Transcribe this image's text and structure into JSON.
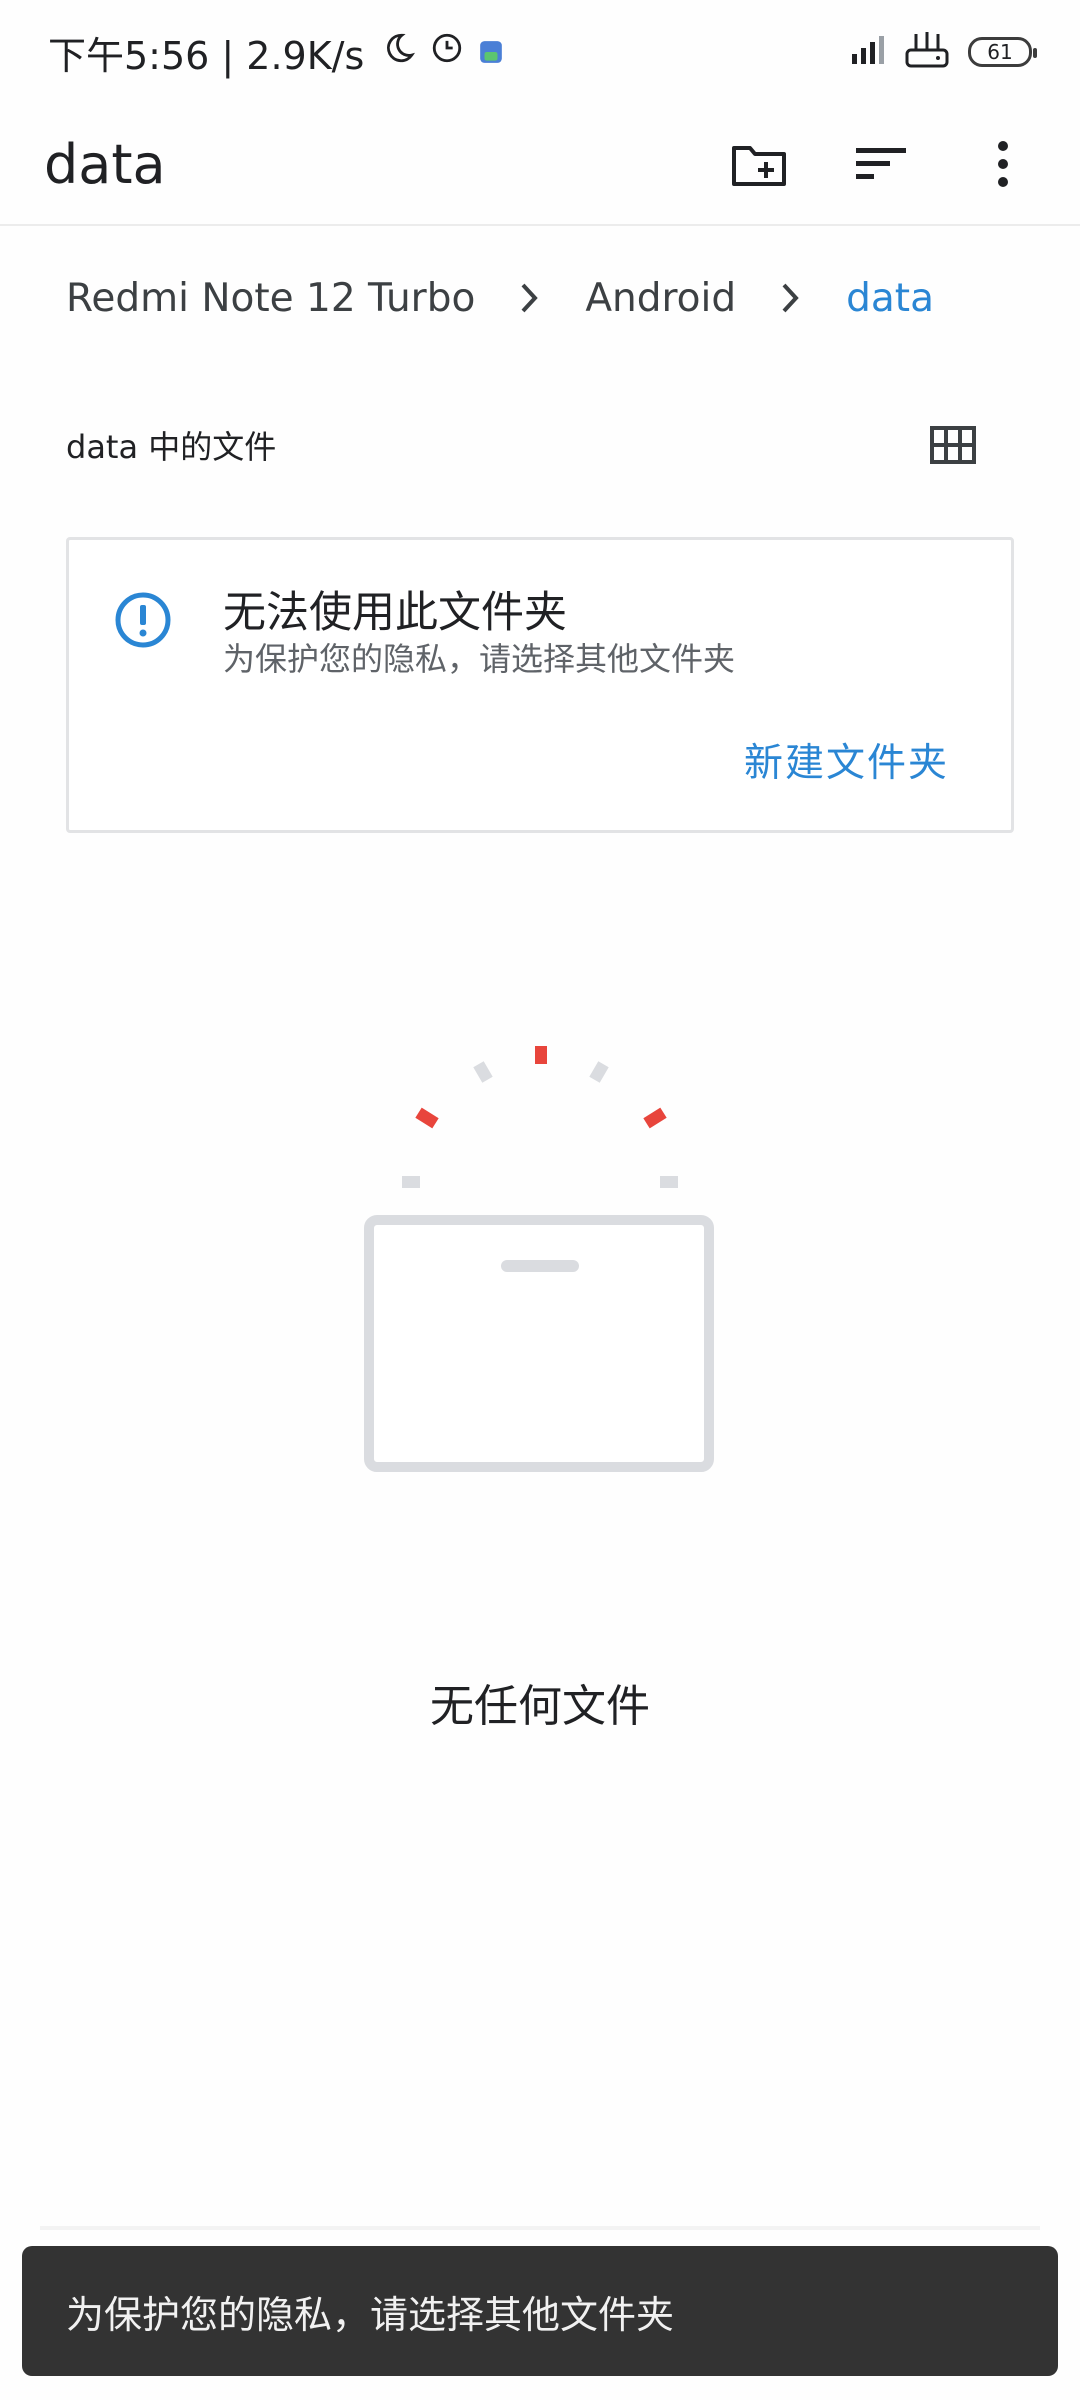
{
  "status_bar": {
    "time_and_speed": "下午5:56 | 2.9K/s",
    "battery_level": "61"
  },
  "app_bar": {
    "title": "data",
    "new_folder_icon": "create-new-folder-icon",
    "sort_icon": "sort-icon",
    "more_icon": "more-vertical-icon"
  },
  "breadcrumb": {
    "items": [
      "Redmi Note 12 Turbo",
      "Android",
      "data"
    ]
  },
  "section": {
    "title": "data 中的文件",
    "view_toggle_icon": "grid-view-icon"
  },
  "info_card": {
    "title": "无法使用此文件夹",
    "subtitle": "为保护您的隐私，请选择其他文件夹",
    "action_label": "新建文件夹",
    "icon": "info-alert-icon"
  },
  "empty_state": {
    "text": "无任何文件"
  },
  "snackbar": {
    "message": "为保护您的隐私，请选择其他文件夹"
  },
  "colors": {
    "accent": "#2a86d4",
    "illustration_red": "#e8453c",
    "illustration_gray": "#dadce0",
    "snackbar_bg": "#333333"
  }
}
